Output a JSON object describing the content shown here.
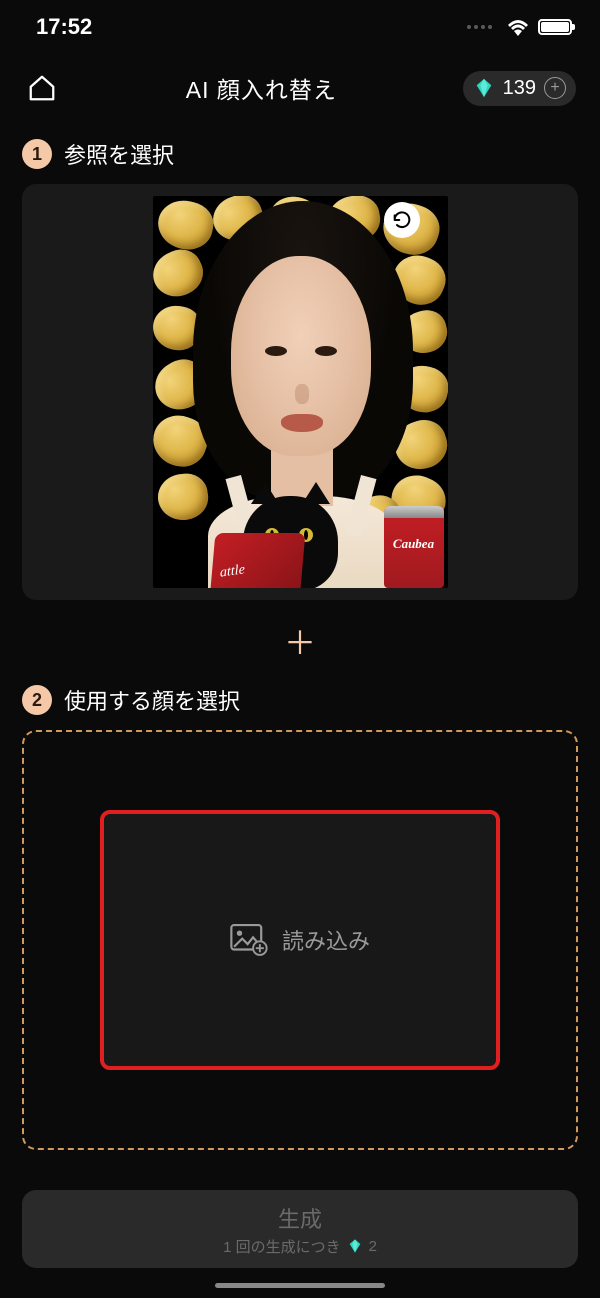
{
  "status": {
    "time": "17:52"
  },
  "header": {
    "title": "AI 顔入れ替え",
    "credits": "139"
  },
  "step1": {
    "num": "1",
    "label": "参照を選択"
  },
  "image": {
    "can_text": "Caubea",
    "bag_text": "attle"
  },
  "plus": "＋",
  "step2": {
    "num": "2",
    "label": "使用する顔を選択",
    "upload": "読み込み"
  },
  "generate": {
    "label": "生成",
    "sub_prefix": "1 回の生成につき",
    "cost": "2"
  }
}
